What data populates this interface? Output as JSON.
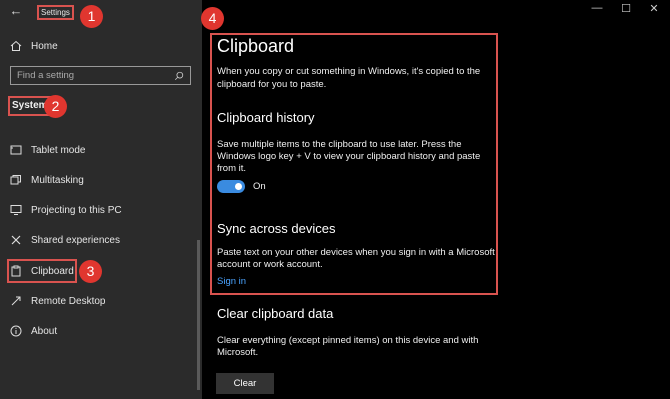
{
  "window": {
    "title": "Settings",
    "controls": {
      "minimize": "—",
      "maximize": "☐",
      "close": "✕"
    }
  },
  "sidebar": {
    "home": "Home",
    "search_placeholder": "Find a setting",
    "section": "System",
    "items": [
      {
        "label": "Tablet mode",
        "icon": "tablet-mode-icon"
      },
      {
        "label": "Multitasking",
        "icon": "multitasking-icon"
      },
      {
        "label": "Projecting to this PC",
        "icon": "projecting-icon"
      },
      {
        "label": "Shared experiences",
        "icon": "shared-experiences-icon"
      },
      {
        "label": "Clipboard",
        "icon": "clipboard-icon"
      },
      {
        "label": "Remote Desktop",
        "icon": "remote-desktop-icon"
      },
      {
        "label": "About",
        "icon": "info-icon"
      }
    ]
  },
  "badges": [
    "1",
    "2",
    "3",
    "4"
  ],
  "main": {
    "title": "Clipboard",
    "intro_line1": "When you copy or cut something in Windows, it's copied to the",
    "intro_line2": "clipboard for you to paste.",
    "history": {
      "heading": "Clipboard history",
      "desc_line1": "Save multiple items to the clipboard to use later. Press the",
      "desc_line2": "Windows logo key + V to view your clipboard history and paste",
      "desc_line3": "from it.",
      "toggle_state": "On"
    },
    "sync": {
      "heading": "Sync across devices",
      "desc_line1": "Paste text on your other devices when you sign in with a Microsoft",
      "desc_line2": "account or work account.",
      "link": "Sign in"
    },
    "clear": {
      "heading": "Clear clipboard data",
      "desc_line1": "Clear everything (except pinned items) on this device and with",
      "desc_line2": "Microsoft.",
      "button": "Clear"
    }
  },
  "colors": {
    "sidebar_bg": "#2b2b2b",
    "main_bg": "#000000",
    "accent": "#3a8be0",
    "link": "#4aa3ff",
    "highlight": "#d9534f",
    "badge": "#e0362f"
  }
}
